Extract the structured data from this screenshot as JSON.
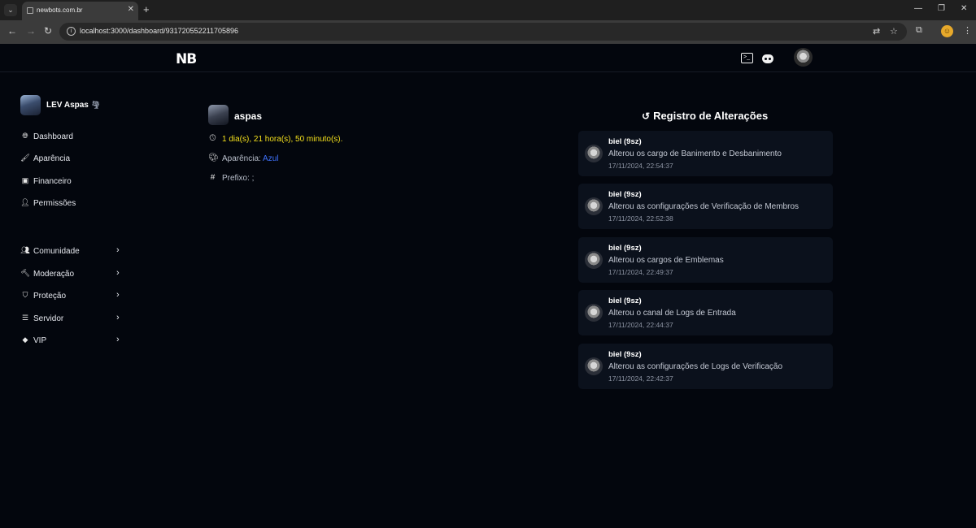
{
  "browser": {
    "tab_title": "newbots.com.br",
    "url": "localhost:3000/dashboard/931720552211705896"
  },
  "header": {
    "logo": "NB"
  },
  "sidebar": {
    "user_name": "LEV Aspas",
    "user_emoji": "🌪",
    "items": [
      {
        "label": "Dashboard",
        "icon": "globe-icon"
      },
      {
        "label": "Aparência",
        "icon": "brush-icon"
      },
      {
        "label": "Financeiro",
        "icon": "money-icon"
      },
      {
        "label": "Permissões",
        "icon": "user-gear-icon"
      }
    ],
    "groups": [
      {
        "label": "Comunidade",
        "icon": "users-icon"
      },
      {
        "label": "Moderação",
        "icon": "gavel-icon"
      },
      {
        "label": "Proteção",
        "icon": "shield-icon"
      },
      {
        "label": "Servidor",
        "icon": "server-icon"
      },
      {
        "label": "VIP",
        "icon": "gem-icon"
      }
    ]
  },
  "guild": {
    "name": "aspas",
    "uptime": "1 dia(s), 21 hora(s), 50 minuto(s).",
    "appearance_label": "Aparência:",
    "appearance_value": "Azul",
    "prefix_label": "Prefixo: ;"
  },
  "changelog": {
    "title": "Registro de Alterações",
    "entries": [
      {
        "user": "biel (9sz)",
        "action": "Alterou os cargo de Banimento e Desbanimento",
        "time": "17/11/2024, 22:54:37"
      },
      {
        "user": "biel (9sz)",
        "action": "Alterou as configurações de Verificação de Membros",
        "time": "17/11/2024, 22:52:38"
      },
      {
        "user": "biel (9sz)",
        "action": "Alterou os cargos de Emblemas",
        "time": "17/11/2024, 22:49:37"
      },
      {
        "user": "biel (9sz)",
        "action": "Alterou o canal de Logs de Entrada",
        "time": "17/11/2024, 22:44:37"
      },
      {
        "user": "biel (9sz)",
        "action": "Alterou as configurações de Logs de Verificação",
        "time": "17/11/2024, 22:42:37"
      }
    ]
  },
  "colors": {
    "background": "#03060d",
    "card": "#0b111c",
    "uptime": "#f4e01c",
    "accent": "#3f73ff"
  }
}
